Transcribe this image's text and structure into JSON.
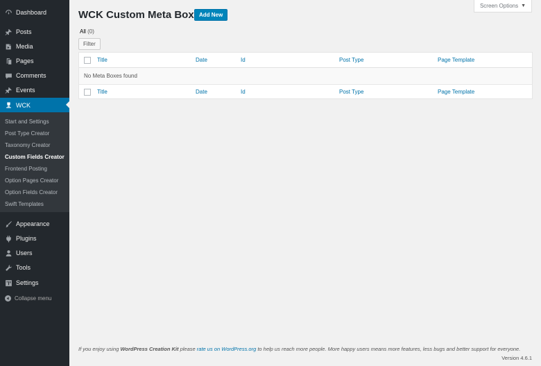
{
  "sidebar": {
    "items": [
      {
        "label": "Dashboard",
        "icon": "dashboard-icon"
      },
      {
        "label": "Posts",
        "icon": "pin-icon"
      },
      {
        "label": "Media",
        "icon": "media-icon"
      },
      {
        "label": "Pages",
        "icon": "pages-icon"
      },
      {
        "label": "Comments",
        "icon": "comment-icon"
      },
      {
        "label": "Events",
        "icon": "pin-icon"
      },
      {
        "label": "WCK",
        "icon": "wck-icon"
      }
    ],
    "submenu": [
      {
        "label": "Start and Settings"
      },
      {
        "label": "Post Type Creator"
      },
      {
        "label": "Taxonomy Creator"
      },
      {
        "label": "Custom Fields Creator"
      },
      {
        "label": "Frontend Posting"
      },
      {
        "label": "Option Pages Creator"
      },
      {
        "label": "Option Fields Creator"
      },
      {
        "label": "Swift Templates"
      }
    ],
    "items2": [
      {
        "label": "Appearance",
        "icon": "brush-icon"
      },
      {
        "label": "Plugins",
        "icon": "plugin-icon"
      },
      {
        "label": "Users",
        "icon": "user-icon"
      },
      {
        "label": "Tools",
        "icon": "wrench-icon"
      },
      {
        "label": "Settings",
        "icon": "settings-icon"
      }
    ],
    "collapse": "Collapse menu"
  },
  "screen_options": "Screen Options",
  "page_title": "WCK Custom Meta Boxes",
  "add_new": "Add New",
  "filter_all": {
    "label": "All",
    "count": "(0)"
  },
  "filter_button": "Filter",
  "table": {
    "columns": [
      "Title",
      "Date",
      "Id",
      "Post Type",
      "Page Template"
    ],
    "empty_message": "No Meta Boxes found"
  },
  "footer": {
    "text_pre": "If you enjoy using ",
    "text_brand": "WordPress Creation Kit",
    "text_mid": " please ",
    "link": "rate us on WordPress.org",
    "text_post": " to help us reach more people. More happy users means more features, less bugs and better support for everyone.",
    "version": "Version 4.6.1"
  },
  "colors": {
    "accent": "#0073aa",
    "sidebar_bg": "#23282d",
    "submenu_bg": "#32373c",
    "button": "#0085ba"
  }
}
